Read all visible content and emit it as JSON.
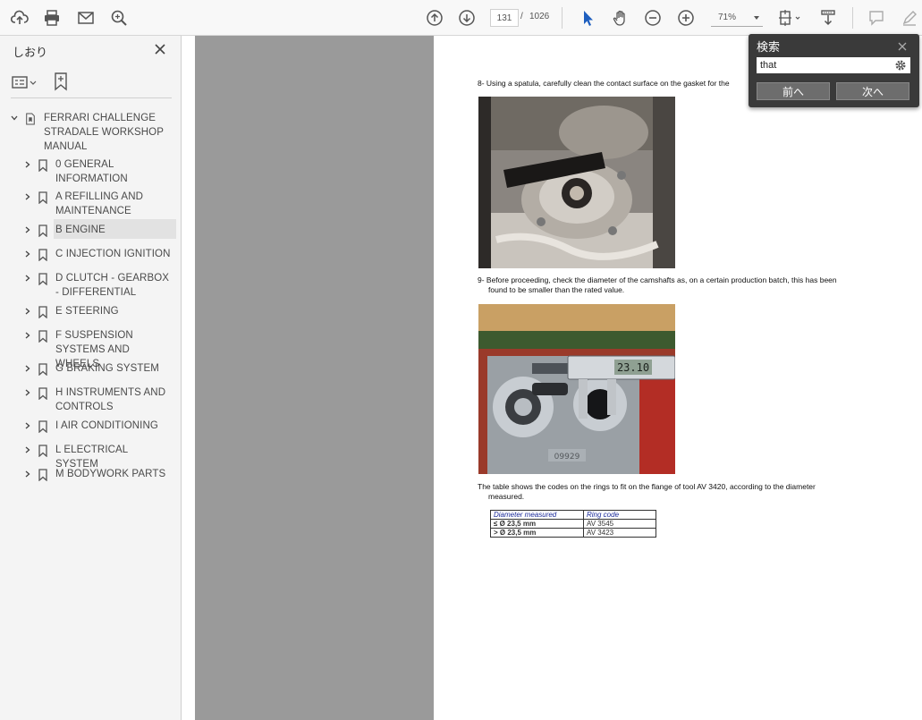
{
  "toolbar": {
    "page_current": "131",
    "page_separator": "/",
    "page_total": "1026",
    "zoom": "71%"
  },
  "sidebar": {
    "title": "しおり",
    "items": [
      {
        "label": "FERRARI CHALLENGE STRADALE WORKSHOP MANUAL"
      },
      {
        "label": "0 GENERAL INFORMATION"
      },
      {
        "label": "A REFILLING AND MAINTENANCE"
      },
      {
        "label": "B ENGINE"
      },
      {
        "label": "C INJECTION IGNITION"
      },
      {
        "label": "D CLUTCH - GEARBOX - DIFFERENTIAL"
      },
      {
        "label": "E STEERING"
      },
      {
        "label": "F SUSPENSION SYSTEMS AND WHEELS"
      },
      {
        "label": "G BRAKING SYSTEM"
      },
      {
        "label": "H INSTRUMENTS AND CONTROLS"
      },
      {
        "label": "I AIR CONDITIONING"
      },
      {
        "label": "L ELECTRICAL SYSTEM"
      },
      {
        "label": "M BODYWORK PARTS"
      }
    ]
  },
  "document": {
    "step8": "8- Using a spatula, carefully clean the contact surface on the gasket for the",
    "step9_line1": "9- Before proceeding, check the diameter of the camshafts as, on a certain production batch, this has been",
    "step9_line2": "found to be smaller than the rated value.",
    "caliper_reading": "23.10",
    "engine_number": "09929",
    "table_intro_line1": "The table shows the codes on the rings to fit on the flange of tool AV 3420, according to the diameter",
    "table_intro_line2": "measured.",
    "table": {
      "headers": [
        "Diameter measured",
        "Ring code"
      ],
      "rows": [
        [
          "≤ Ø 23,5 mm",
          "AV 3545"
        ],
        [
          "> Ø 23,5 mm",
          "AV 3423"
        ]
      ]
    }
  },
  "search": {
    "title": "検索",
    "query": "that",
    "prev_label": "前へ",
    "next_label": "次へ"
  }
}
